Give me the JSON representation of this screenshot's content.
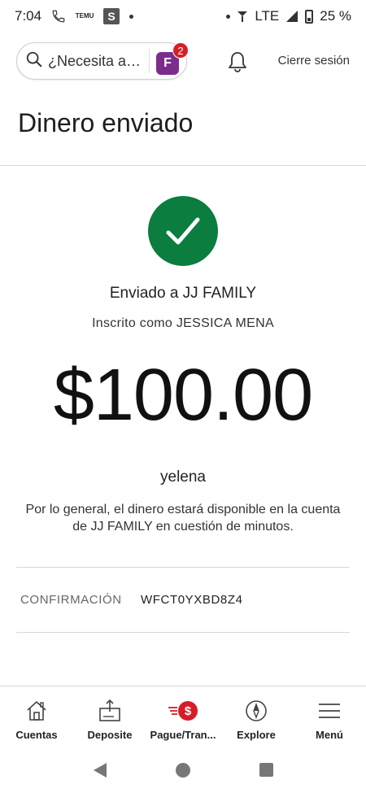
{
  "status_bar": {
    "time": "7:04",
    "temu_label": "TEMU",
    "s_label": "S",
    "network": "LTE",
    "battery": "25 %"
  },
  "header": {
    "search_placeholder": "¿Necesita ayuda?",
    "notification_count": "2",
    "fargo_icon_label": "F",
    "logout_label": "Cierre sesión"
  },
  "page": {
    "title": "Dinero enviado"
  },
  "confirmation": {
    "sent_to": "Enviado a JJ FAMILY",
    "enrolled_as": "Inscrito como JESSICA MENA",
    "amount": "$100.00",
    "memo": "yelena",
    "note": "Por lo general, el dinero estará disponible en la cuenta de JJ FAMILY en cuestión de minutos.",
    "label": "CONFIRMACIÓN",
    "code": "WFCT0YXBD8Z4"
  },
  "bottom_nav": {
    "items": [
      {
        "label": "Cuentas",
        "icon": "house-icon"
      },
      {
        "label": "Deposite",
        "icon": "deposit-icon"
      },
      {
        "label": "Pague/Tran...",
        "icon": "pay-transfer-icon"
      },
      {
        "label": "Explore",
        "icon": "compass-icon"
      },
      {
        "label": "Menú",
        "icon": "hamburger-menu-icon"
      }
    ]
  },
  "colors": {
    "success_green": "#0a7d3f",
    "brand_red": "#d71e28",
    "fargo_purple": "#7b2d8e"
  }
}
